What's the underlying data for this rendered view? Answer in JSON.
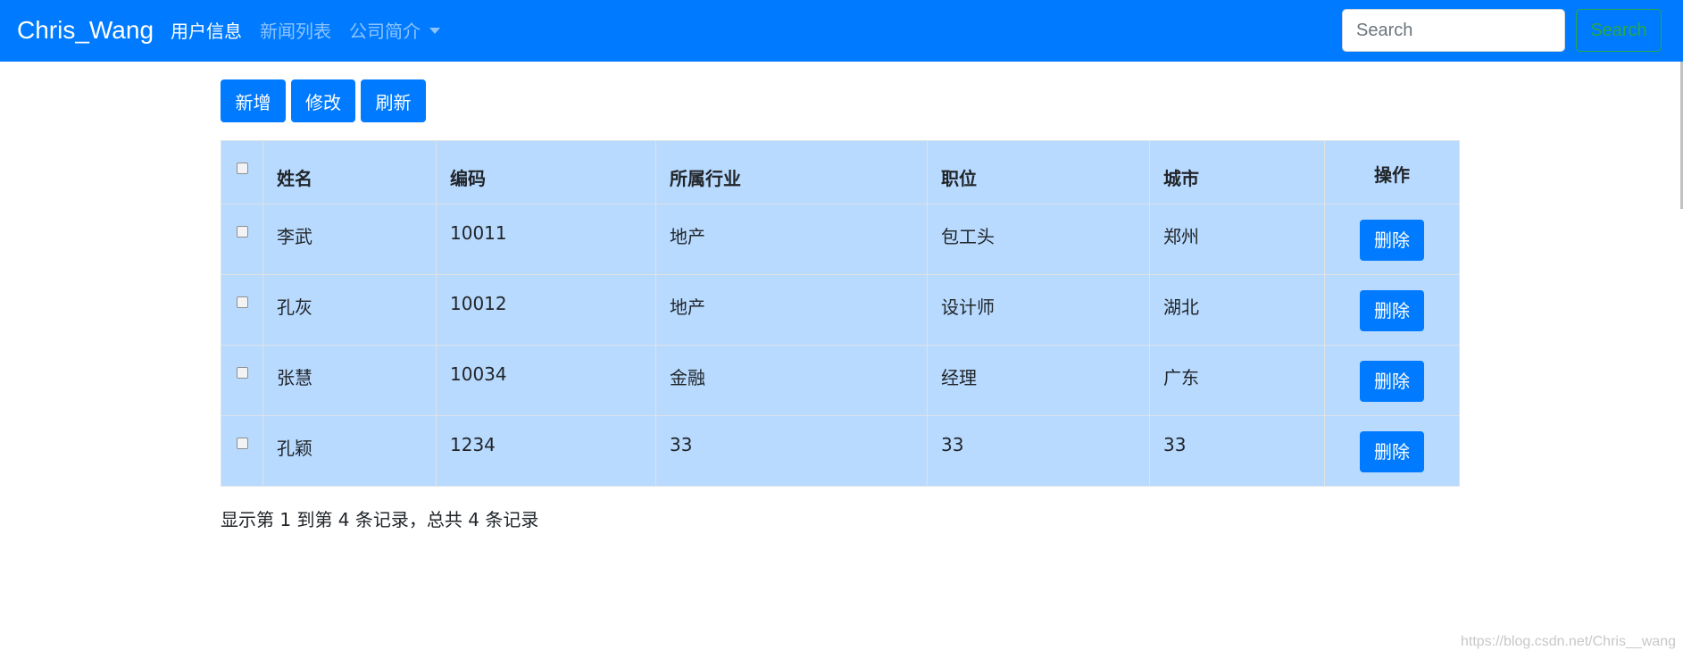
{
  "navbar": {
    "brand": "Chris_Wang",
    "links": [
      {
        "label": "用户信息",
        "active": true
      },
      {
        "label": "新闻列表",
        "active": false
      },
      {
        "label": "公司简介",
        "active": false,
        "dropdown": true
      }
    ],
    "search_placeholder": "Search",
    "search_button": "Search"
  },
  "toolbar": {
    "add_label": "新增",
    "edit_label": "修改",
    "refresh_label": "刷新"
  },
  "table": {
    "headers": [
      "姓名",
      "编码",
      "所属行业",
      "职位",
      "城市",
      "操作"
    ],
    "rows": [
      {
        "name": "李武",
        "code": "10011",
        "industry": "地产",
        "position": "包工头",
        "city": "郑州",
        "action": "删除"
      },
      {
        "name": "孔灰",
        "code": "10012",
        "industry": "地产",
        "position": "设计师",
        "city": "湖北",
        "action": "删除"
      },
      {
        "name": "张慧",
        "code": "10034",
        "industry": "金融",
        "position": "经理",
        "city": "广东",
        "action": "删除"
      },
      {
        "name": "孔颖",
        "code": "1234",
        "industry": "33",
        "position": "33",
        "city": "33",
        "action": "删除"
      }
    ]
  },
  "pagination_info": "显示第 1 到第 4 条记录，总共 4 条记录",
  "watermark": "https://blog.csdn.net/Chris__wang",
  "colors": {
    "primary": "#007bff",
    "table_bg": "#b8daff",
    "success": "#28a745"
  }
}
